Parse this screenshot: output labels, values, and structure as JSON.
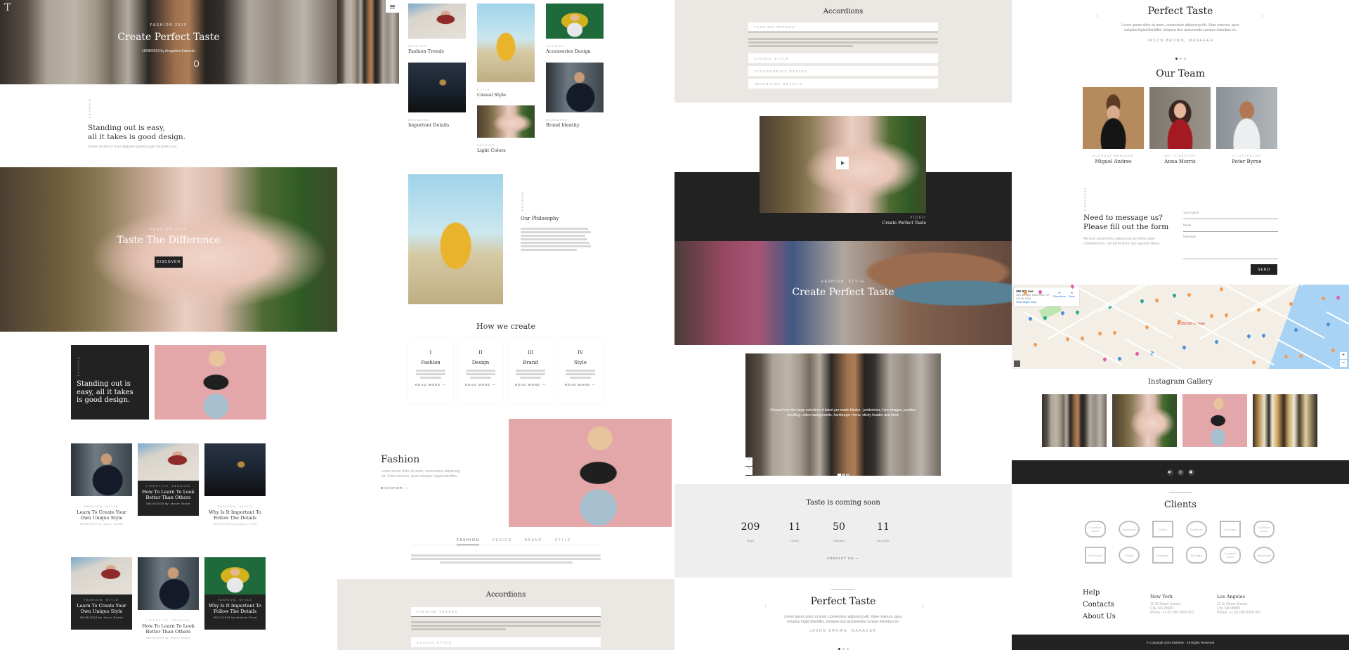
{
  "colors": {
    "dark": "#222222",
    "beige": "#ebe7e3",
    "light_gray": "#eeeeee",
    "text": "#333333",
    "muted": "#aaaaaa"
  },
  "header": {
    "logo": "T",
    "menu_icon": "hamburger-menu-icon"
  },
  "hero": {
    "kicker": "Fashion 2019",
    "title": "Create Perfect Taste",
    "meta": "18/08/2019 by Anagelina Edwards",
    "scroll_icon": "mouse-scroll-icon"
  },
  "intro": {
    "vertical_label": "Fashion",
    "heading_line1": "Standing out is easy,",
    "heading_line2": "all it takes is good design.",
    "text": "Donec et nibh in risus aliquam gravida eget sit amet nunc."
  },
  "banner": {
    "kicker": "Fashion 2019",
    "title": "Taste The Difference",
    "button": "Discover"
  },
  "quote_block": {
    "vertical_label": "Fashion",
    "text": "Standing out is easy, all it takes is good design."
  },
  "posts_row1": [
    {
      "category": "Fashion, Style",
      "title": "Learn To Create Your Own Unique Style",
      "meta": "28/08/2019 by Jason Brown",
      "dark": false
    },
    {
      "category": "Lifestyle, Fashion",
      "title": "How To Learn To Look Better Than Others",
      "meta": "08/10/2019 by Jessie Stone",
      "dark": true
    },
    {
      "category": "Fashion, Style",
      "title": "Why Is It Important To Follow The Details",
      "meta": "18/11/2019 by Andrew Pearl",
      "dark": false
    }
  ],
  "posts_row2": [
    {
      "category": "Fashion, Style",
      "title": "Learn To Create Your Own Unique Style",
      "meta": "28/08/2019 by Jason Brown",
      "dark": true
    },
    {
      "category": "Lifestyle, Fashion",
      "title": "How To Learn To Look Better Than Others",
      "meta": "08/10/2019 by Jessie Stone",
      "dark": false
    },
    {
      "category": "Fashion, Style",
      "title": "Why Is It Important To Follow The Details",
      "meta": "18/11/2019 by Andrew Pearl",
      "dark": true
    }
  ],
  "portfolio": [
    {
      "label": "Fashion",
      "title": "Fashion Trends"
    },
    {
      "label": "Style",
      "title": "Casual Style"
    },
    {
      "label": "Fashion",
      "title": "Accessories Design"
    },
    {
      "label": "Branding",
      "title": "Important Details"
    },
    {
      "label": "Fashion",
      "title": "Light Colors"
    },
    {
      "label": "Branding",
      "title": "Brand Identity"
    }
  ],
  "philosophy": {
    "vertical_label": "Fashion",
    "title": "Our Philosophy"
  },
  "how_we_create": {
    "title": "How we create",
    "steps": [
      {
        "numeral": "I",
        "title": "Fashion",
        "link": "Read more"
      },
      {
        "numeral": "II",
        "title": "Design",
        "link": "Read more"
      },
      {
        "numeral": "III",
        "title": "Brand",
        "link": "Read more"
      },
      {
        "numeral": "IV",
        "title": "Style",
        "link": "Read more"
      }
    ]
  },
  "fashion_feature": {
    "title": "Fashion",
    "text": "Lorem ipsum dolor sit amet, consectetur adipiscing elit. Vitae nostrum, quos voluptas fugiat blanditiis.",
    "link": "Discover"
  },
  "tabs": {
    "items": [
      "Fashion",
      "Design",
      "Brand",
      "Style"
    ],
    "active": 0
  },
  "accordions": {
    "title": "Accordions",
    "items": [
      "Fashion Trends",
      "Casual Style",
      "Accessories Design",
      "Important Details"
    ],
    "open": 0
  },
  "video": {
    "label": "Video",
    "title": "Create Perfect Taste",
    "play_icon": "play-icon"
  },
  "banner2": {
    "kicker": "Fashion, Style",
    "title": "Create Perfect Taste"
  },
  "slider": {
    "text": "Choose from the large selection of latest pre-made blocks - jumbotrons, hero images, parallax scrolling, video backgrounds, hamburger menu, sticky header and more",
    "active_dot": 0,
    "dots": 3
  },
  "countdown": {
    "title": "Taste is coming soon",
    "units": [
      {
        "value": "209",
        "label": "Days"
      },
      {
        "value": "11",
        "label": "Hours"
      },
      {
        "value": "50",
        "label": "Minutes"
      },
      {
        "value": "11",
        "label": "Seconds"
      }
    ],
    "link": "Contact us"
  },
  "testimonial": {
    "title": "Perfect Taste",
    "text_line1": "Lorem ipsum dolor sit amet, consectetur adipiscing elit. Vitae nostrum, quos",
    "text_line2": "voluptas fugiat blanditiis, tempora duo assumenda cumque doloribus eo.",
    "author": "Jason Brown, Manager",
    "dots": 3,
    "active_dot": 0
  },
  "team": {
    "title": "Our Team",
    "members": [
      {
        "role": "Account Manager",
        "name": "Miguel Andres"
      },
      {
        "role": "Art Director",
        "name": "Anna Morris"
      },
      {
        "role": "Illustrator",
        "name": "Peter Byrne"
      }
    ]
  },
  "contact": {
    "vertical_label": "Contacts",
    "heading_line1": "Need to message us?",
    "heading_line2": "Please fill out the form",
    "text": "Aenean consectetur adipiscing ero tellus vitae condimentum, nisi porta dolor duo egestas libero.",
    "name_placeholder": "Your Name",
    "email_placeholder": "Email",
    "message_placeholder": "Message",
    "send": "Send"
  },
  "map": {
    "place": "350 5th Ave",
    "address": "350 5th Ave, New York, NY 10118, USA",
    "directions": "Directions",
    "save": "Save",
    "larger_map": "View larger map",
    "marker": "350 5th Avenue",
    "zoom_in": "+",
    "zoom_out": "−"
  },
  "instagram": {
    "title": "Instagram Gallery"
  },
  "social": [
    "video-icon",
    "dribbble-icon",
    "instagram-icon"
  ],
  "clients": {
    "title": "Clients",
    "logos": [
      "Comfort Zone",
      "Starhead",
      "Style",
      "Emblem",
      "Vintage",
      "Comfort Zone",
      "Starhead",
      "Style",
      "Emblem",
      "Vintage",
      "Comfort Zone",
      "Starhead"
    ]
  },
  "footer": {
    "links": [
      "Help",
      "Contacts",
      "About Us"
    ],
    "offices": [
      {
        "city": "New York",
        "line1": "12 St Street Sunset",
        "line2": "City, NA 98989",
        "line3": "Phone: +1 (0) 000 0000 001"
      },
      {
        "city": "Los Angeles",
        "line1": "12 St Street Sunset",
        "line2": "City, NA 98989",
        "line3": "Phone: +1 (0) 000 0000 001"
      }
    ],
    "copyright": "© Copyright 2019 Mobirise - All Rights Reserved"
  }
}
